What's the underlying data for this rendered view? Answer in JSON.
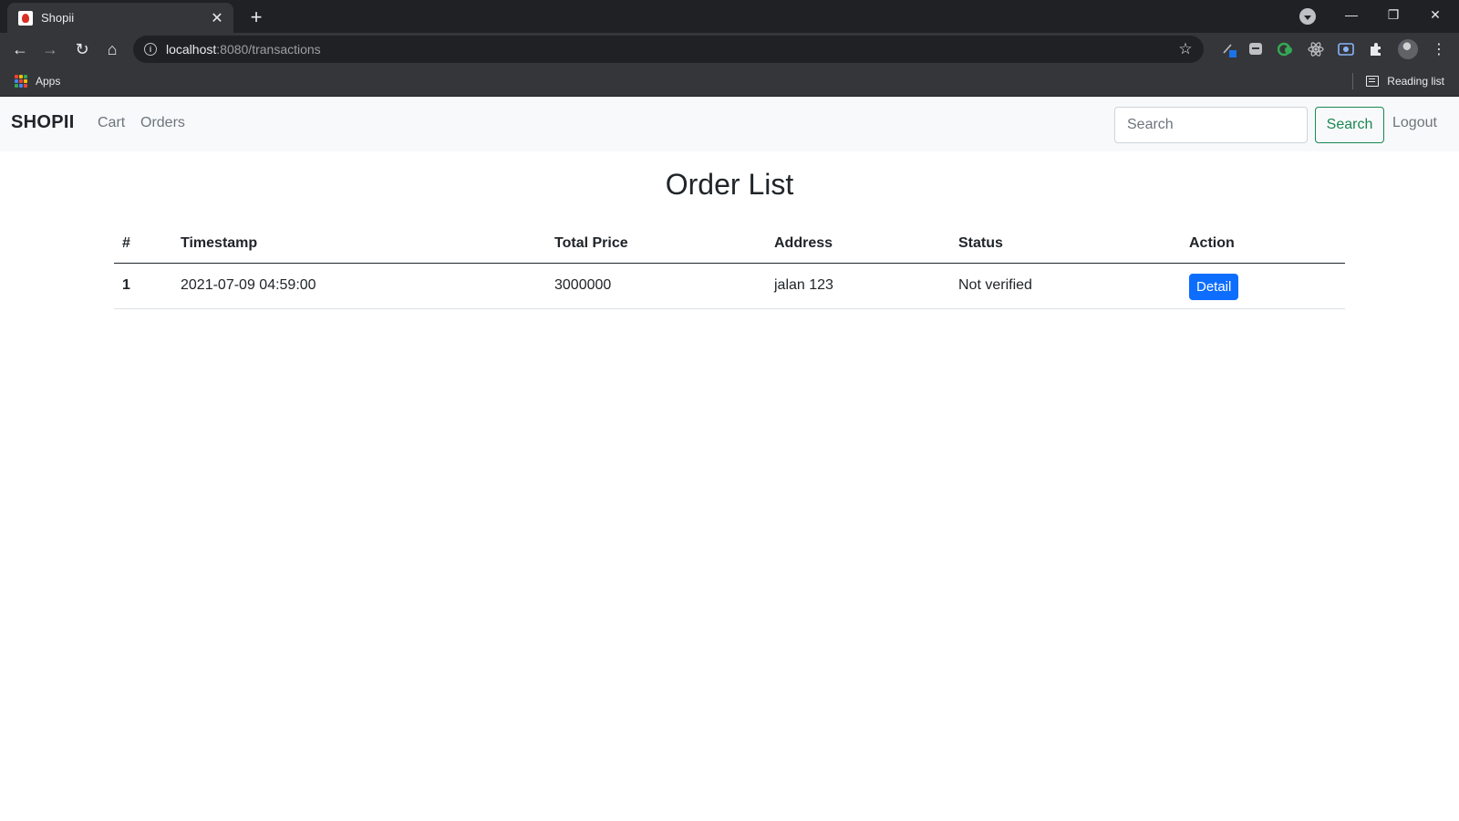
{
  "browser": {
    "tab_title": "Shopii",
    "tab_close": "✕",
    "new_tab": "+",
    "url_host": "localhost",
    "url_path": ":8080/transactions",
    "bookmarks_apps": "Apps",
    "reading_list": "Reading list",
    "icons": {
      "back": "←",
      "forward": "→",
      "reload": "↻",
      "home": "⌂",
      "star": "☆",
      "minimize": "—",
      "restore": "❐",
      "close": "✕",
      "menu": "⋮"
    }
  },
  "navbar": {
    "brand": "SHOPII",
    "links": [
      "Cart",
      "Orders"
    ],
    "search_placeholder": "Search",
    "search_button": "Search",
    "logout": "Logout"
  },
  "main": {
    "title": "Order List",
    "table": {
      "headers": [
        "#",
        "Timestamp",
        "Total Price",
        "Address",
        "Status",
        "Action"
      ],
      "rows": [
        {
          "num": "1",
          "timestamp": "2021-07-09 04:59:00",
          "total_price": "3000000",
          "address": "jalan 123",
          "status": "Not verified",
          "action": "Detail"
        }
      ]
    }
  },
  "colors": {
    "primary": "#0d6efd",
    "success": "#198754",
    "navbar_bg": "#f8f9fa",
    "chrome_dark": "#202124",
    "chrome_toolbar": "#35363a"
  }
}
